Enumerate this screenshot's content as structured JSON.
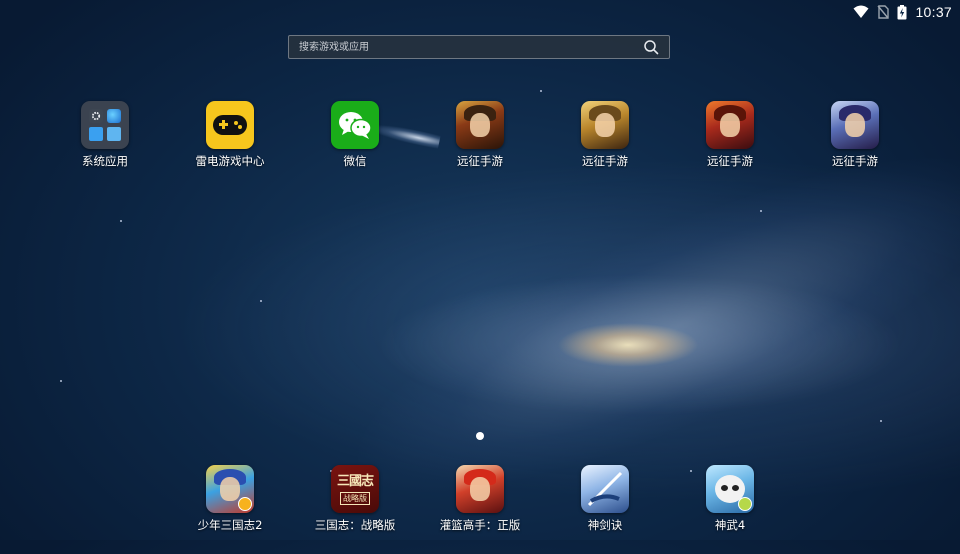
{
  "status_bar": {
    "time": "10:37",
    "icons": [
      "wifi-icon",
      "no-sim-icon",
      "battery-charging-icon"
    ]
  },
  "search": {
    "placeholder": "搜索游戏或应用",
    "icon": "search-icon"
  },
  "apps_top": [
    {
      "label": "系统应用",
      "icon": "folder-icon"
    },
    {
      "label": "雷电游戏中心",
      "icon": "gamepad-icon"
    },
    {
      "label": "微信",
      "icon": "wechat-icon"
    },
    {
      "label": "远征手游",
      "icon": "game-art-icon"
    },
    {
      "label": "远征手游",
      "icon": "game-art-icon"
    },
    {
      "label": "远征手游",
      "icon": "game-art-icon"
    },
    {
      "label": "远征手游",
      "icon": "game-art-icon"
    }
  ],
  "dock": [
    {
      "label": "少年三国志2",
      "icon": "game-art-icon"
    },
    {
      "label": "三国志：战略版",
      "icon": "game-art-icon",
      "art_title": "三國志",
      "art_sub": "战略版"
    },
    {
      "label": "灌篮高手：正版",
      "icon": "game-art-icon"
    },
    {
      "label": "神剑诀",
      "icon": "game-art-icon"
    },
    {
      "label": "神武4",
      "icon": "game-art-icon"
    }
  ],
  "pager": {
    "pages": 1,
    "current": 1
  },
  "colors": {
    "wallpaper": "#0d2746",
    "game_center_yellow": "#f6c61d",
    "wechat_green": "#1aad19"
  }
}
